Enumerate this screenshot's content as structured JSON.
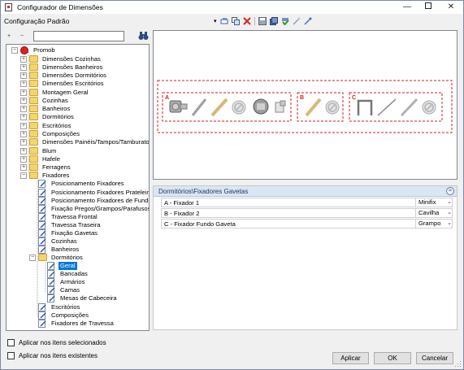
{
  "window": {
    "title": "Configurador de Dimensões",
    "minimize": "—",
    "close": "✕"
  },
  "toolbar": {
    "config_label": "Configuração Padrão",
    "dropdown_arrow": "▾"
  },
  "tree_toolbar": {
    "search_value": "",
    "expand_all": "+",
    "collapse_all": "−"
  },
  "tree": {
    "root": "Promob",
    "items": [
      "Dimensões Cozinhas",
      "Dimensões Banheiros",
      "Dimensões Dormitórios",
      "Dimensões Escritórios",
      "Montagem Geral",
      "Cozinhas",
      "Banheiros",
      "Dormitórios",
      "Escritórios",
      "Composições",
      "Dimensões Painéis/Tampos/Tamburatos",
      "Blum",
      "Hafele",
      "Ferragens",
      "Fixadores",
      "Posicionamento Fixadores",
      "Posicionamento Fixadores Prateleiras",
      "Posicionamento Fixadores de Fundo",
      "Fixação Pregos/Grampos/Parafusos",
      "Travessa Frontal",
      "Travessa Traseira",
      "Fixação Gavetas",
      "Cozinhas",
      "Banheiros",
      "Dormitórios",
      "Geral",
      "Bancadas",
      "Armários",
      "Camas",
      "Mesas de Cabeceira",
      "Escritórios",
      "Composições",
      "Fixadores de Travessa"
    ]
  },
  "preview": {
    "groups": [
      "A",
      "B",
      "C"
    ]
  },
  "properties": {
    "header": "Dormitórios\\Fixadores Gavetas",
    "collapse_glyph": "≈",
    "rows": [
      {
        "name": "A - Fixador 1",
        "value": "Minifix"
      },
      {
        "name": "B - Fixador 2",
        "value": "Cavilha"
      },
      {
        "name": "C - Fixador Fundo Gaveta",
        "value": "Grampo"
      }
    ],
    "dropdown_glyph": "⌄"
  },
  "options": {
    "apply_selected": "Aplicar nos itens selecionados",
    "apply_existing": "Aplicar nos itens existentes"
  },
  "buttons": {
    "apply": "Aplicar",
    "ok": "OK",
    "cancel": "Cancelar"
  },
  "colors": {
    "selection": "#0078d7",
    "header_bg": "#dae6f3",
    "dashed_red": "#d21f1f"
  }
}
